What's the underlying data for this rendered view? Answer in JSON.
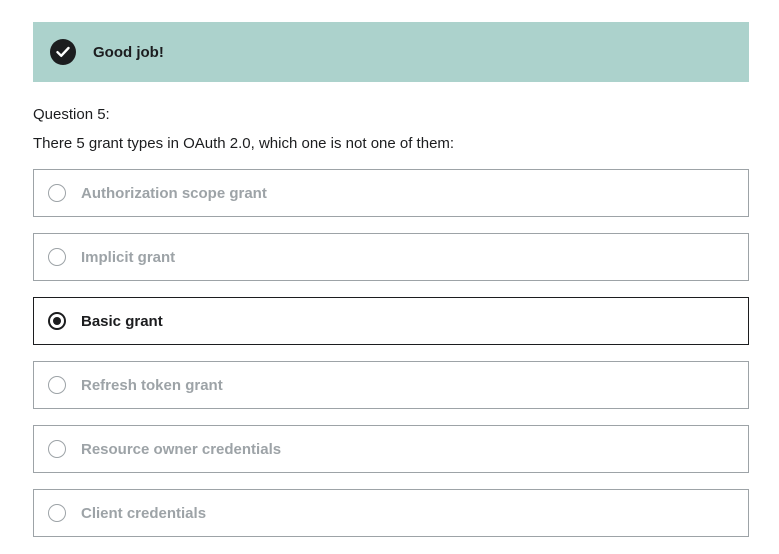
{
  "banner": {
    "icon": "check-circle-icon",
    "text": "Good job!",
    "color": "#acd2cc"
  },
  "question": {
    "label": "Question 5:",
    "text": "There 5 grant types in OAuth 2.0, which one is not one of them:"
  },
  "options": [
    {
      "label": "Authorization scope grant",
      "selected": false
    },
    {
      "label": "Implicit grant",
      "selected": false
    },
    {
      "label": "Basic grant",
      "selected": true
    },
    {
      "label": "Refresh token grant",
      "selected": false
    },
    {
      "label": "Resource owner credentials",
      "selected": false
    },
    {
      "label": "Client credentials",
      "selected": false
    }
  ]
}
